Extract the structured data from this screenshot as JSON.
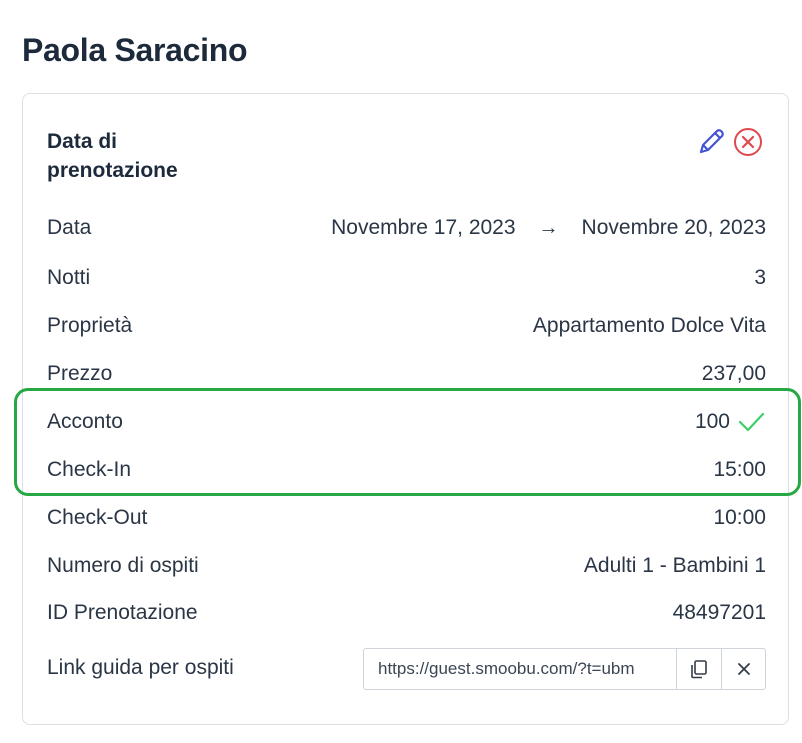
{
  "guest": {
    "name": "Paola Saracino"
  },
  "booking_card": {
    "title": "Data di prenotazione",
    "edit_icon": "pencil-icon",
    "delete_icon": "close-circle-icon",
    "rows": {
      "date": {
        "label": "Data",
        "start": "Novembre 17, 2023",
        "arrow": "→",
        "end": "Novembre 20, 2023"
      },
      "nights": {
        "label": "Notti",
        "value": "3"
      },
      "property": {
        "label": "Proprietà",
        "value": "Appartamento Dolce Vita"
      },
      "price": {
        "label": "Prezzo",
        "value": "237,00"
      },
      "deposit": {
        "label": "Acconto",
        "value": "100",
        "paid_icon": "check-icon"
      },
      "checkin": {
        "label": "Check-In",
        "value": "15:00"
      },
      "checkout": {
        "label": "Check-Out",
        "value": "10:00"
      },
      "guests": {
        "label": "Numero di ospiti",
        "value": "Adulti 1 - Bambini 1"
      },
      "booking_id": {
        "label": "ID Prenotazione",
        "value": "48497201"
      }
    },
    "guest_link": {
      "label": "Link guida per ospiti",
      "value": "https://guest.smoobu.com/?t=ubm",
      "copy_icon": "copy-icon",
      "clear_icon": "close-icon"
    }
  },
  "colors": {
    "heading": "#1d2a3b",
    "text": "#2a3646",
    "edit_icon": "#4353d6",
    "delete_icon": "#e0484f",
    "check": "#3ccf6a",
    "highlight": "#27a844",
    "border": "#dcdfe4"
  }
}
